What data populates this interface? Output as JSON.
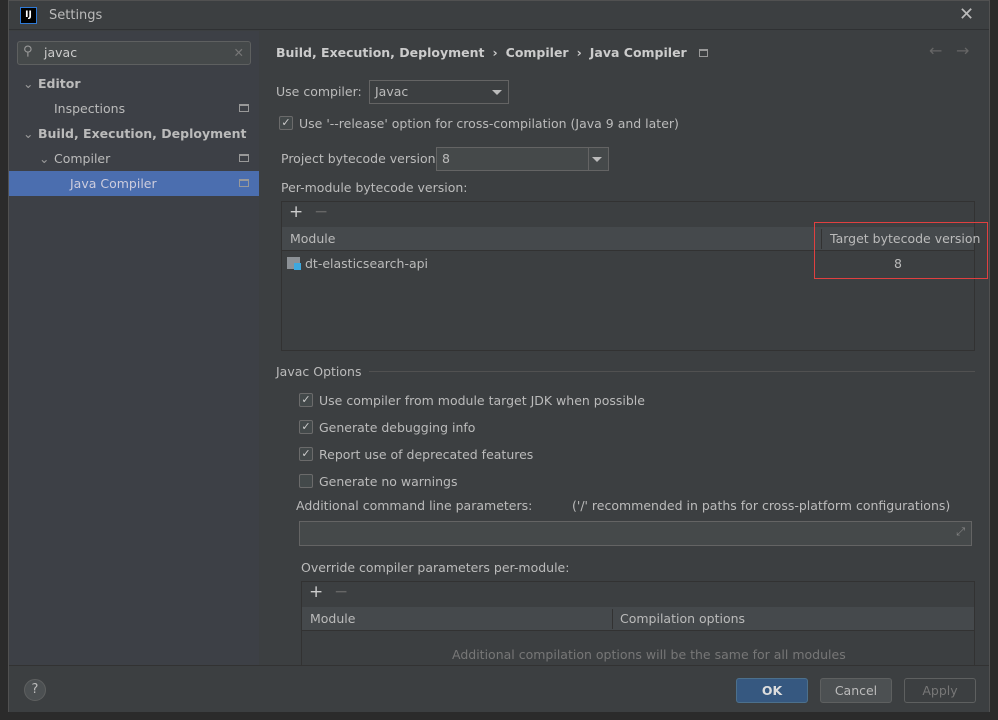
{
  "window": {
    "title": "Settings",
    "logo": "IJ"
  },
  "search": {
    "value": "javac"
  },
  "tree": [
    {
      "label": "Editor",
      "bold": true
    },
    {
      "label": "Inspections"
    },
    {
      "label": "Build, Execution, Deployment",
      "bold": true
    },
    {
      "label": "Compiler"
    },
    {
      "label": "Java Compiler",
      "selected": true
    }
  ],
  "breadcrumb": [
    "Build, Execution, Deployment",
    "Compiler",
    "Java Compiler"
  ],
  "compiler": {
    "label": "Use compiler:",
    "value": "Javac"
  },
  "release_option": {
    "label": "Use '--release' option for cross-compilation (Java 9 and later)",
    "checked": true
  },
  "project_bytecode": {
    "label": "Project bytecode version:",
    "value": "8"
  },
  "per_module": {
    "label": "Per-module bytecode version:",
    "columns": [
      "Module",
      "Target bytecode version"
    ],
    "rows": [
      {
        "module": "dt-elasticsearch-api",
        "version": "8"
      }
    ]
  },
  "javac_options": {
    "title": "Javac Options",
    "checkboxes": [
      {
        "label": "Use compiler from module target JDK when possible",
        "checked": true
      },
      {
        "label": "Generate debugging info",
        "checked": true
      },
      {
        "label": "Report use of deprecated features",
        "checked": true
      },
      {
        "label": "Generate no warnings",
        "checked": false
      }
    ],
    "cmd_label": "Additional command line parameters:",
    "cmd_hint": "('/' recommended in paths for cross-platform configurations)",
    "cmd_value": ""
  },
  "override": {
    "label": "Override compiler parameters per-module:",
    "columns": [
      "Module",
      "Compilation options"
    ],
    "empty_text": "Additional compilation options will be the same for all modules"
  },
  "footer": {
    "help": "?",
    "ok": "OK",
    "cancel": "Cancel",
    "apply": "Apply"
  },
  "colors": {
    "accent": "#4b6eaf",
    "ok_button": "#365880",
    "highlight_box": "#e04040"
  }
}
